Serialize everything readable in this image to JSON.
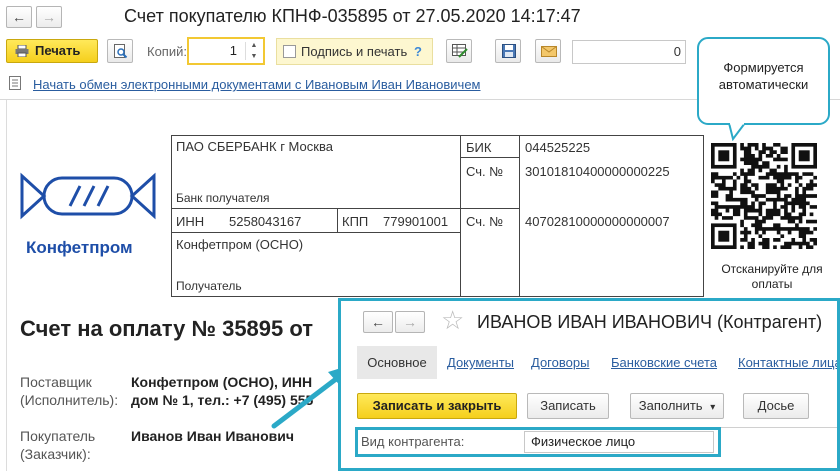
{
  "window": {
    "title": "Счет покупателю КПНФ-035895 от 27.05.2020 14:17:47",
    "back_glyph": "←",
    "forward_glyph": "→"
  },
  "toolbar": {
    "print_label": "Печать",
    "copies_label": "Копий:",
    "copies_value": "1",
    "sign_and_print_label": "Подпись и печать",
    "help_glyph": "?",
    "number_value": "0"
  },
  "exchange_link": "Начать обмен электронными документами с Ивановым Иван Ивановичем",
  "logo": {
    "brand": "Конфетпром"
  },
  "bank": {
    "bank_name": "ПАО СБЕРБАНК г Москва",
    "bank_caption": "Банк получателя",
    "bik_label": "БИК",
    "bik_value": "044525225",
    "corr_label": "Сч. №",
    "corr_value": "30101810400000000225",
    "inn_label": "ИНН",
    "inn_value": "5258043167",
    "kpp_label": "КПП",
    "kpp_value": "779901001",
    "account_label": "Сч. №",
    "account_value": "40702810000000000007",
    "recipient_name": "Конфетпром (ОСНО)",
    "recipient_caption": "Получатель"
  },
  "qr": {
    "caption_line1": "Отсканируйте для",
    "caption_line2": "оплаты"
  },
  "callout": {
    "line1": "Формируется",
    "line2": "автоматически"
  },
  "invoice": {
    "title": "Счет на оплату № 35895 от",
    "supplier_label_1": "Поставщик",
    "supplier_label_2": "(Исполнитель):",
    "supplier_value_1": "Конфетпром (ОСНО), ИНН",
    "supplier_value_2": "дом № 1, тел.: +7 (495) 555",
    "buyer_label_1": "Покупатель",
    "buyer_label_2": "(Заказчик):",
    "buyer_value": "Иванов Иван Иванович"
  },
  "counterparty": {
    "title": "ИВАНОВ ИВАН ИВАНОВИЧ (Контрагент)",
    "star_glyph": "☆",
    "tabs": [
      "Основное",
      "Документы",
      "Договоры",
      "Банковские счета",
      "Контактные лица"
    ],
    "save_close_label": "Записать и закрыть",
    "save_label": "Записать",
    "fill_label": "Заполнить",
    "fill_arrow": "▾",
    "dossier_label": "Досье",
    "kind_label": "Вид контрагента:",
    "kind_value": "Физическое лицо"
  },
  "colors": {
    "accent_yellow": "#f5cf1c",
    "callout_border": "#2ba9c7",
    "link": "#2a5d9f",
    "brand_blue": "#1e4ea8"
  }
}
